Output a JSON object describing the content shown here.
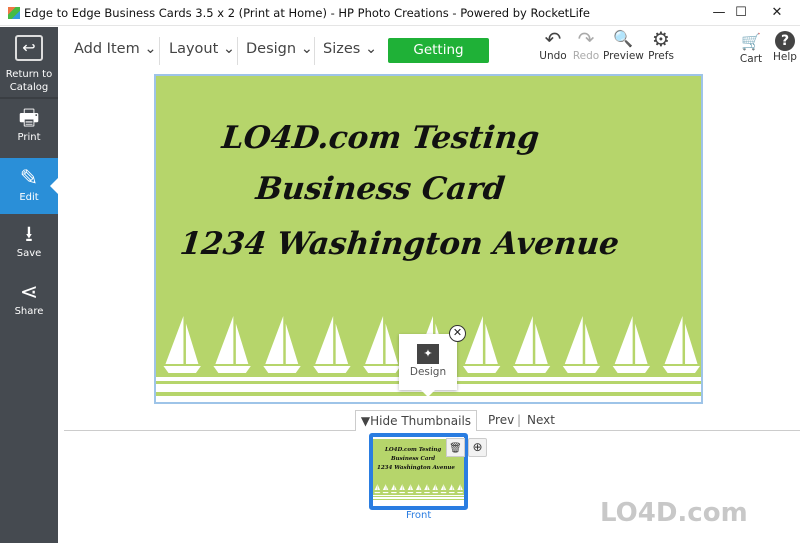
{
  "window": {
    "title": "Edge to Edge Business Cards 3.5 x 2 (Print at Home) - HP Photo Creations - Powered by RocketLife",
    "minimize": "—",
    "maximize": "☐",
    "close": "✕"
  },
  "sidebar": {
    "items": [
      {
        "label": "Return to Catalog",
        "icon": "return-icon",
        "glyph": "↩"
      },
      {
        "label": "Print",
        "icon": "printer-icon",
        "glyph": "🖶"
      },
      {
        "label": "Edit",
        "icon": "pencil-icon",
        "glyph": "✎",
        "active": true
      },
      {
        "label": "Save",
        "icon": "save-icon",
        "glyph": "⭳"
      },
      {
        "label": "Share",
        "icon": "share-icon",
        "glyph": "⋖"
      }
    ]
  },
  "toolbar": {
    "menus": [
      "Add Item",
      "Layout",
      "Design",
      "Sizes"
    ],
    "chevron": "⌄",
    "getting_started": "Getting Started",
    "buttons": [
      {
        "label": "Undo",
        "glyph": "↶",
        "enabled": true
      },
      {
        "label": "Redo",
        "glyph": "↷",
        "enabled": false
      },
      {
        "label": "Preview",
        "glyph": "🔍"
      },
      {
        "label": "Prefs",
        "glyph": "⚙"
      },
      {
        "label": "Cart",
        "glyph": "🛒"
      },
      {
        "label": "Help",
        "glyph": "?"
      }
    ]
  },
  "card": {
    "lines": [
      "LO4D.com Testing",
      "Business Card",
      "1234 Washington Avenue"
    ],
    "background": "#b6d56b"
  },
  "popup": {
    "label": "Design",
    "glyph": "✦",
    "close": "✕"
  },
  "thumbnails": {
    "hide_label": "▼Hide Thumbnails",
    "prev": "Prev",
    "sep": "|",
    "next": "Next",
    "front_label": "Front",
    "delete_glyph": "🗑",
    "add_glyph": "⊕"
  },
  "colors": {
    "accent": "#2a8fd8",
    "sidebar": "#454a50",
    "green_button": "#1fb137"
  },
  "watermark": "LO4D.com"
}
